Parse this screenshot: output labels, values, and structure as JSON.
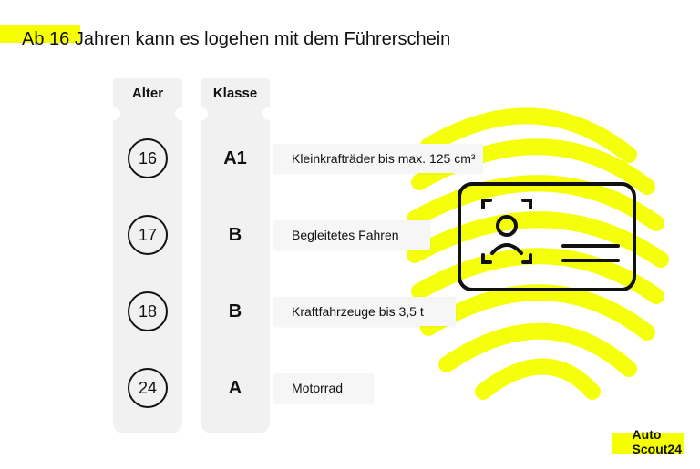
{
  "title": "Ab 16 Jahren kann es logehen mit dem Führerschein",
  "columns": {
    "age_header": "Alter",
    "class_header": "Klasse"
  },
  "rows": [
    {
      "age": "16",
      "class": "A1",
      "desc": "Kleinkrafträder bis max. 125 cm³"
    },
    {
      "age": "17",
      "class": "B",
      "desc": "Begleitetes Fahren"
    },
    {
      "age": "18",
      "class": "B",
      "desc": "Kraftfahrzeuge bis 3,5 t"
    },
    {
      "age": "24",
      "class": "A",
      "desc": "Motorrad"
    }
  ],
  "brand": {
    "line1": "Auto",
    "line2": "Scout24"
  },
  "colors": {
    "highlight": "#f5ff00"
  }
}
